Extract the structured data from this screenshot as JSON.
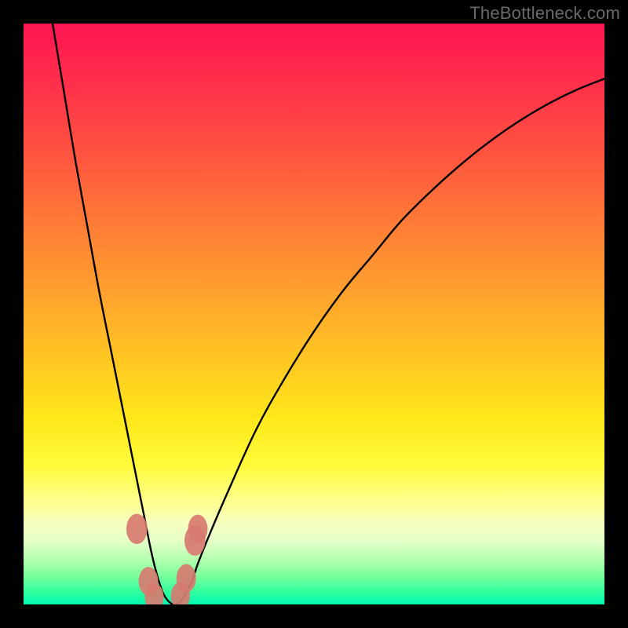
{
  "watermark": {
    "text": "TheBottleneck.com"
  },
  "chart_data": {
    "type": "line",
    "title": "",
    "xlabel": "",
    "ylabel": "",
    "xlim": [
      0,
      100
    ],
    "ylim": [
      0,
      100
    ],
    "grid": false,
    "legend": false,
    "series": [
      {
        "name": "curve",
        "x": [
          5,
          7,
          9,
          11,
          13,
          15,
          17,
          19,
          20,
          21,
          22,
          23,
          24,
          25,
          26,
          27,
          28,
          29,
          30,
          32,
          35,
          40,
          45,
          50,
          55,
          60,
          65,
          70,
          75,
          80,
          85,
          90,
          95,
          100
        ],
        "values": [
          100,
          88,
          76,
          65,
          54,
          44,
          34,
          24,
          19,
          14,
          9,
          5,
          2,
          0.5,
          0,
          0.5,
          2,
          4,
          7,
          12,
          19,
          30,
          39,
          47,
          54,
          60,
          66,
          71,
          75.5,
          79.5,
          83,
          86,
          88.5,
          90.5
        ]
      }
    ],
    "markers": [
      {
        "x": 19.5,
        "y": 13,
        "r": 1.8
      },
      {
        "x": 21.5,
        "y": 4,
        "r": 1.6
      },
      {
        "x": 22.5,
        "y": 1.3,
        "r": 1.5
      },
      {
        "x": 27,
        "y": 1.5,
        "r": 1.5
      },
      {
        "x": 28,
        "y": 4.5,
        "r": 1.6
      },
      {
        "x": 29.5,
        "y": 11,
        "r": 1.8
      },
      {
        "x": 30,
        "y": 13,
        "r": 1.6
      }
    ],
    "background_gradient": [
      "#ff1452",
      "#ff7a36",
      "#ffe81a",
      "#7cff99",
      "#00f7b0"
    ]
  }
}
